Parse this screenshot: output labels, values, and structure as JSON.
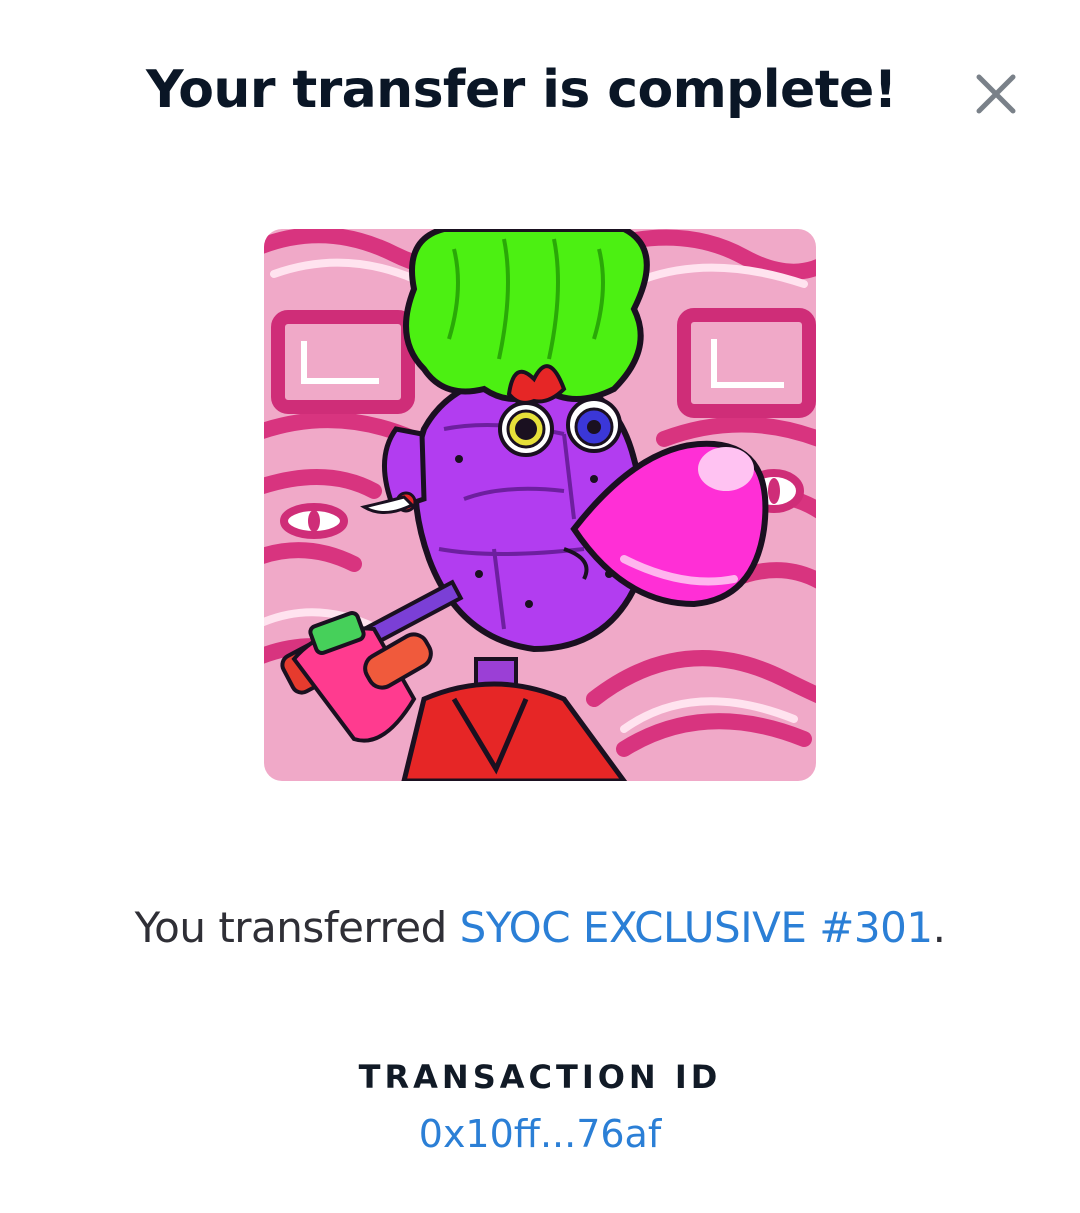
{
  "modal": {
    "title": "Your transfer is complete!",
    "close_icon": "close-icon"
  },
  "nft": {
    "image_description_icon": "nft-artwork-image"
  },
  "message": {
    "prefix": "You transferred ",
    "nft_name": "SYOC EXCLUSIVE #301",
    "suffix": "."
  },
  "transaction": {
    "label": "TRANSACTION ID",
    "id": "0x10ff...76af"
  },
  "colors": {
    "title": "#0a1626",
    "link": "#2b7fd6",
    "body_text": "#2f2f36",
    "close_icon": "#7a8189"
  }
}
